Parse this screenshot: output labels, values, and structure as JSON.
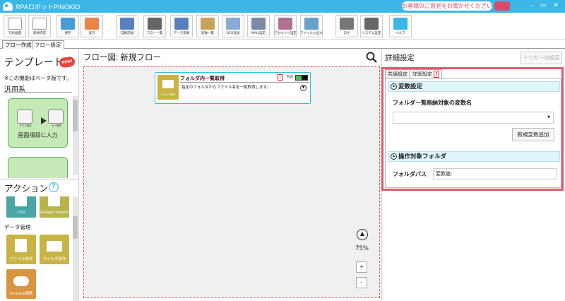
{
  "app": {
    "title": "RPAロボットPINOKIO",
    "feedback": "お客様のご意見をお聞かせください"
  },
  "window": {
    "minimize": "–",
    "restore": "▭",
    "close": "✕"
  },
  "toolbar": [
    {
      "label": "TOP画面",
      "color": "#ffffff"
    },
    {
      "label": "新規作成",
      "color": "#ffffff"
    },
    {
      "label": "保存",
      "color": "#4a9bd6"
    },
    {
      "label": "実行",
      "color": "#e8864a"
    },
    {
      "label": "自動記録",
      "color": "#5a7fc1"
    },
    {
      "label": "フロー一覧",
      "color": "#666666"
    },
    {
      "label": "データ変数",
      "color": "#5a7fc1"
    },
    {
      "label": "変数一覧",
      "color": "#c9a25a"
    },
    {
      "label": "OCR変換",
      "color": "#8aa8d8"
    },
    {
      "label": "MAIL設定",
      "color": "#7c8aa5"
    },
    {
      "label": "アカウント設定",
      "color": "#b07090"
    },
    {
      "label": "ファイル入出力",
      "color": "#6aa0cc"
    },
    {
      "label": "ログ",
      "color": "#777777"
    },
    {
      "label": "システム設定",
      "color": "#666666"
    },
    {
      "label": "ヘルプ",
      "color": "#3ab7e8"
    }
  ],
  "tabs": [
    "フロー作成",
    "フロー設定"
  ],
  "left": {
    "template_title": "テンプレート",
    "new_badge": "NEW!",
    "beta_note": "※この機能はベータ版です。",
    "category": "汎用系",
    "cards": [
      {
        "label": "画面項目に入力",
        "icon_a": "マウス操作",
        "icon_b": "キー操作"
      }
    ],
    "actions_title": "アクション",
    "help": "?",
    "tiles_top": [
      {
        "label": "CSV",
        "color": "#4aa6a6",
        "glyph": "CSV"
      },
      {
        "label": "Google Sheets",
        "color": "#b8b44a",
        "glyph": "G"
      }
    ],
    "data_mgmt": "データ管理",
    "tiles_mid": [
      {
        "label": "ファイル操作",
        "color": "#c9b344"
      },
      {
        "label": "フォルダ操作",
        "color": "#c9b344"
      }
    ],
    "tiles_bottom": [
      {
        "label": "Kintone連携",
        "color": "#d99440"
      }
    ]
  },
  "canvas": {
    "title": "フロー図:  新規フロー",
    "node": {
      "title": "フォルダ内一覧取得",
      "desc": "指定のフォルダからファイル名を一覧取得します。",
      "icon_label": "フォルダ操作",
      "valid": "有効",
      "warn": "!"
    },
    "zoom_up": "▲",
    "zoom": "75%",
    "zoom_in": "+",
    "zoom_out": "-"
  },
  "detail": {
    "title": "詳細設定",
    "trigger": "トリガーの設定",
    "tab_common": "共通設定",
    "tab_detail": "詳細設定",
    "tab_warn": "!",
    "sec1": "変数設定",
    "sec1_label": "フォルダー覧格納対象の変数名",
    "add_var": "新規変数追加",
    "sec2": "操作対象フォルダ",
    "path_label": "フォルダパス",
    "path_value": "変数値:"
  }
}
